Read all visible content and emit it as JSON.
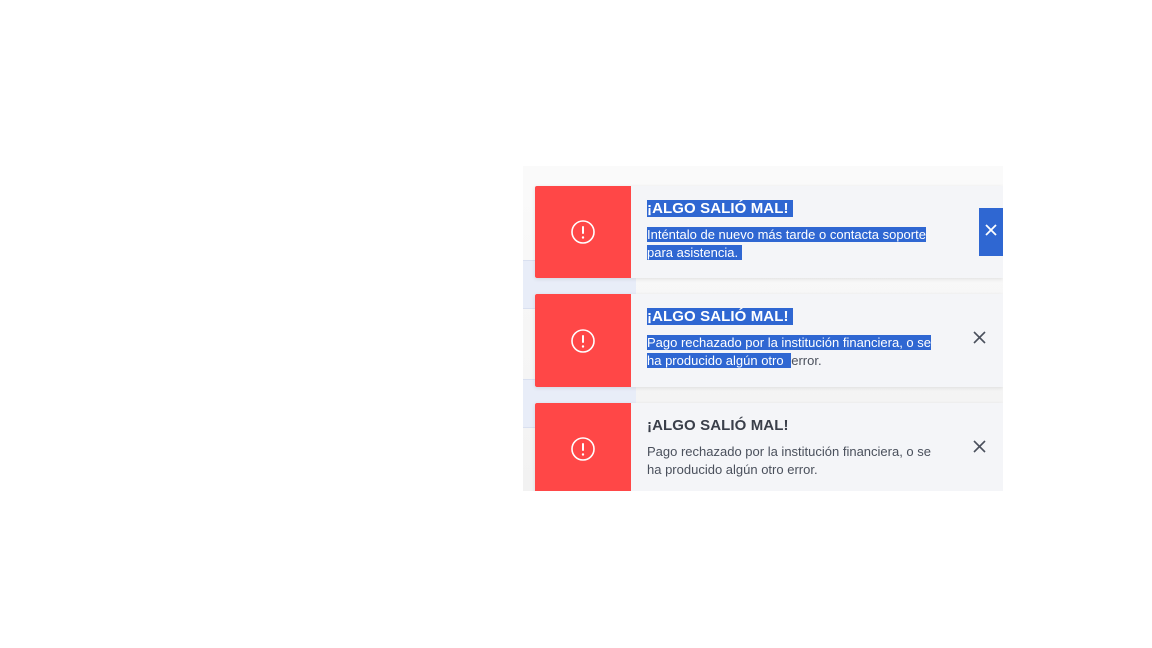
{
  "toasts": [
    {
      "title": "¡ALGO SALIÓ MAL!",
      "message_selected": "Inténtalo de nuevo más tarde o contacta soporte para asistencia.",
      "message_rest": "",
      "icon": "alert-circle-icon",
      "close_icon": "close-icon"
    },
    {
      "title": "¡ALGO SALIÓ MAL!",
      "message_selected": "Pago rechazado por la institución financiera, o se ha producido algún otro ",
      "message_rest": "error.",
      "icon": "alert-circle-icon",
      "close_icon": "close-icon"
    },
    {
      "title": "¡ALGO SALIÓ MAL!",
      "message_selected": "",
      "message_rest": "Pago rechazado por la institución financiera, o se ha producido algún otro error.",
      "icon": "alert-circle-icon",
      "close_icon": "close-icon"
    }
  ],
  "colors": {
    "error_red": "#ff4747",
    "selection_blue": "#2f67d2",
    "toast_bg": "#f4f5f8",
    "text": "#3a3f4a"
  }
}
